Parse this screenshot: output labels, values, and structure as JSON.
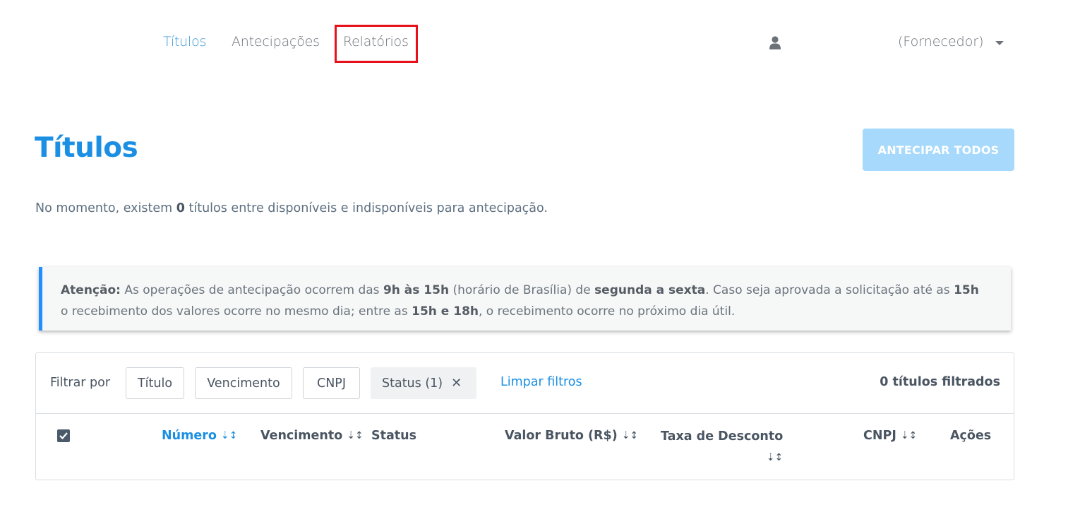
{
  "nav": {
    "items": [
      {
        "label": "Títulos",
        "active": true
      },
      {
        "label": "Antecipações",
        "active": false
      },
      {
        "label": "Relatórios",
        "active": false
      }
    ],
    "user_icon": "user-icon",
    "user_role": "(Fornecedor)",
    "dropdown_icon": "caret-down-icon"
  },
  "page": {
    "title": "Títulos",
    "anticipate_all_label": "ANTECIPAR TODOS",
    "info": {
      "prefix": "No momento, existem ",
      "count": "0",
      "suffix": " títulos entre disponíveis e indisponíveis para antecipação."
    }
  },
  "alert": {
    "label": "Atenção:",
    "t1": " As operações de antecipação ocorrem das ",
    "b1": "9h às 15h",
    "t2": " (horário de Brasília) de ",
    "b2": "segunda a sexta",
    "t3": ". Caso seja aprovada a solicitação até as ",
    "b3": "15h",
    "t4": "o recebimento dos valores ocorre no mesmo dia; entre as ",
    "b4": "15h e 18h",
    "t5": ", o recebimento ocorre no próximo dia útil."
  },
  "filters": {
    "label": "Filtrar por",
    "buttons": [
      "Título",
      "Vencimento",
      "CNPJ"
    ],
    "active_chip": "Status (1)",
    "chip_close": "✕",
    "clear_label": "Limpar filtros",
    "filtered_count": "0 títulos filtrados"
  },
  "table": {
    "select_all_checked": true,
    "columns": [
      "Número",
      "Vencimento",
      "Status",
      "Valor Bruto (R$)",
      "Taxa de Desconto",
      "CNPJ",
      "Ações"
    ],
    "sort_icon": "⇣↕",
    "rows": []
  },
  "colors": {
    "brand_blue": "#1a8fe3",
    "disabled_button": "#a6d9fb",
    "alert_border": "#1e90ff",
    "highlight_red": "#e8101a"
  }
}
